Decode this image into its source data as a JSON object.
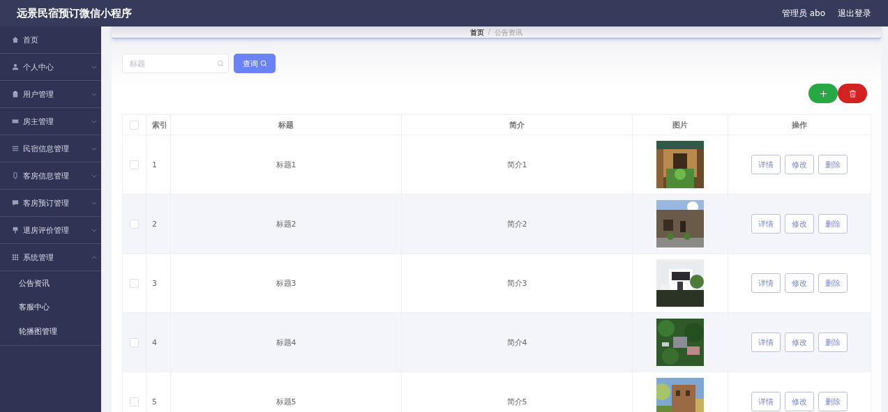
{
  "header": {
    "title": "远景民宿预订微信小程序",
    "user": "管理员 abo",
    "logout": "退出登录"
  },
  "sidebar": {
    "items": [
      {
        "label": "首页"
      },
      {
        "label": "个人中心",
        "expanded": false
      },
      {
        "label": "用户管理",
        "expanded": false
      },
      {
        "label": "房主管理",
        "expanded": false
      },
      {
        "label": "民宿信息管理",
        "expanded": false
      },
      {
        "label": "客房信息管理",
        "expanded": false
      },
      {
        "label": "客房预订管理",
        "expanded": false
      },
      {
        "label": "退房评价管理",
        "expanded": false
      },
      {
        "label": "系统管理",
        "expanded": true,
        "children": [
          {
            "label": "公告资讯"
          },
          {
            "label": "客服中心"
          },
          {
            "label": "轮播图管理"
          }
        ]
      }
    ]
  },
  "breadcrumb": {
    "separator": "/",
    "items": [
      "首页",
      "公告资讯"
    ]
  },
  "search": {
    "placeholder": "标题",
    "button": "查询"
  },
  "table": {
    "header_checked": false,
    "columns": [
      "索引",
      "标题",
      "简介",
      "图片",
      "操作"
    ],
    "rows": [
      {
        "index": "1",
        "title": "标题1",
        "intro": "简介1",
        "checked": false,
        "actions": [
          "详情",
          "修改",
          "删除"
        ]
      },
      {
        "index": "2",
        "title": "标题2",
        "intro": "简介2",
        "checked": false,
        "actions": [
          "详情",
          "修改",
          "删除"
        ]
      },
      {
        "index": "3",
        "title": "标题3",
        "intro": "简介3",
        "checked": false,
        "actions": [
          "详情",
          "修改",
          "删除"
        ]
      },
      {
        "index": "4",
        "title": "标题4",
        "intro": "简介4",
        "checked": false,
        "actions": [
          "详情",
          "修改",
          "删除"
        ]
      },
      {
        "index": "5",
        "title": "标题5",
        "intro": "简介5",
        "checked": false,
        "actions": [
          "详情",
          "修改",
          "删除"
        ]
      }
    ]
  }
}
